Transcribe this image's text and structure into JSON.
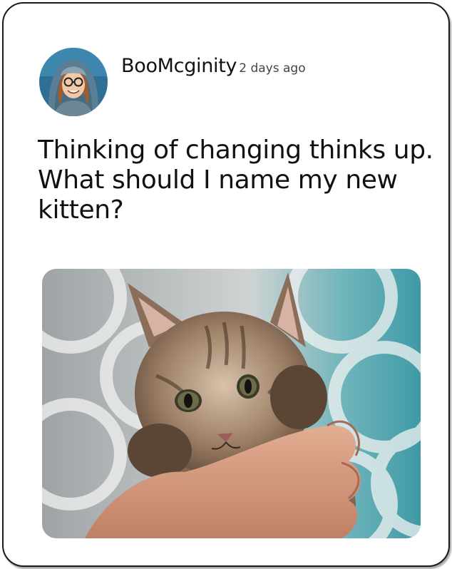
{
  "post": {
    "username": "BooMcginity",
    "timestamp": "2 days ago",
    "text": "Thinking of changing thinks up. What should I name my new kitten?"
  },
  "avatar": {
    "icon": "profile-photo-woman-hood-glasses",
    "colors": {
      "background": "#2f6f96",
      "hood": "#5a7f95",
      "hair": "#a35a2c",
      "skin": "#f1c9a8"
    }
  },
  "photo": {
    "icon": "kitten-photo",
    "colors": {
      "backdrop": "#c8cbcc",
      "teal": "#4aa9b3",
      "fur": "#9c7e66",
      "hand": "#d79a7e"
    }
  }
}
